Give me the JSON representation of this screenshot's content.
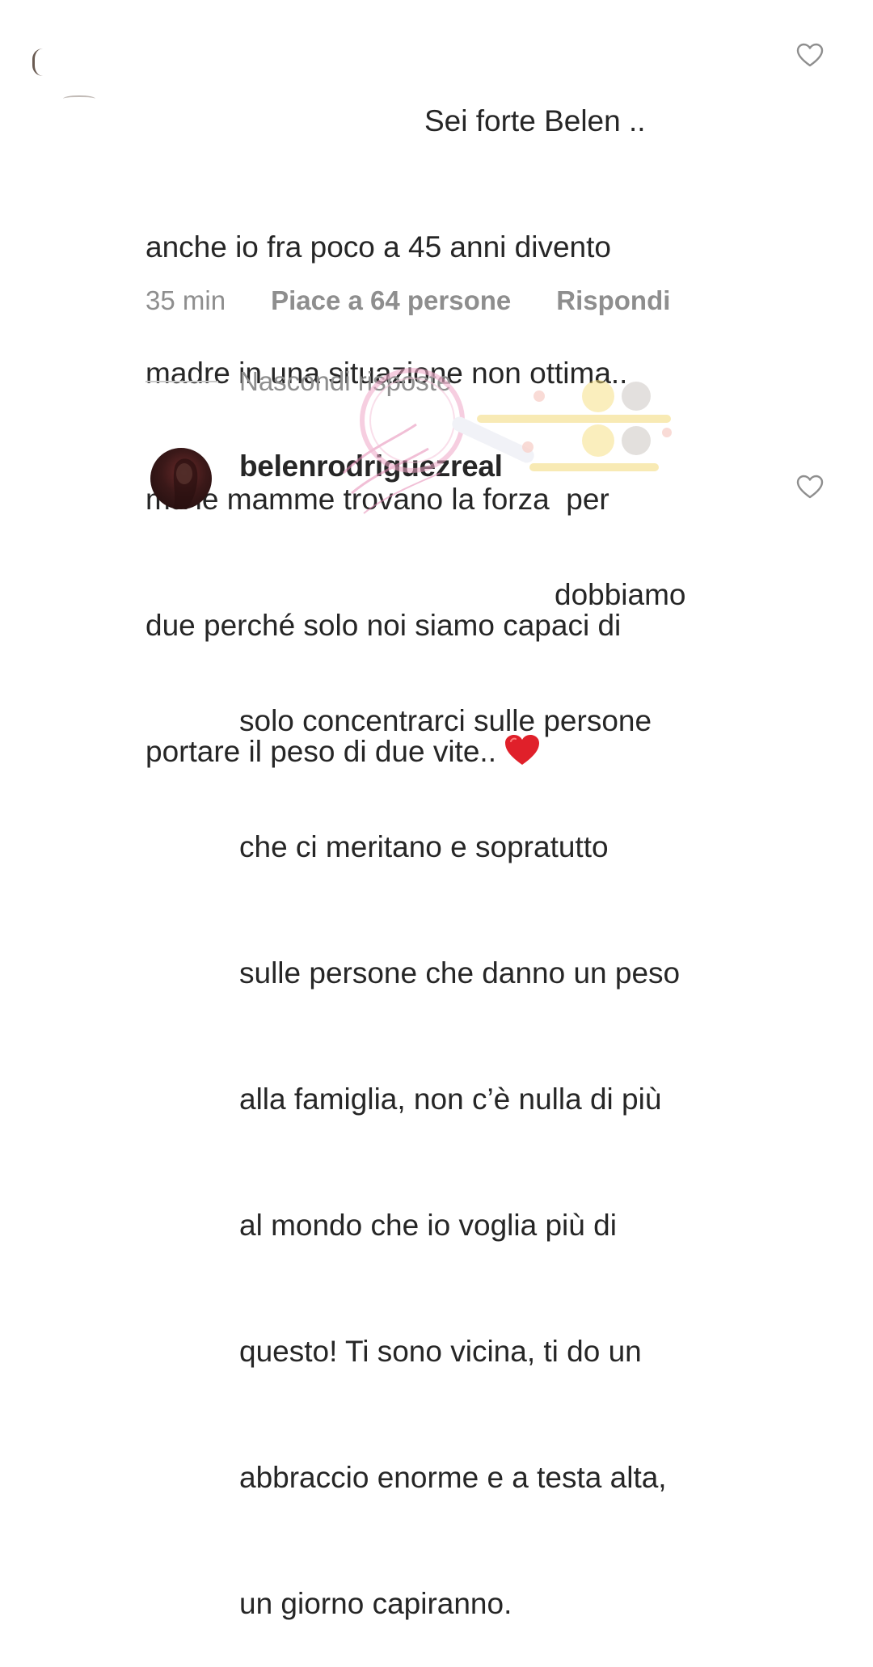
{
  "comment1": {
    "text_lines": [
      "Sei forte Belen ..",
      "anche io fra poco a 45 anni divento",
      "madre in una situazione non ottima..",
      "ma le mamme trovano la forza  per",
      "due perché solo noi siamo capaci di",
      "portare il peso di due vite.."
    ],
    "emoji": "heart-emoji",
    "time": "35 min",
    "likes": "Piace a 64 persone",
    "reply": "Rispondi",
    "like_icon": "heart-outline-icon"
  },
  "replies_toggle": {
    "label": "Nascondi risposte"
  },
  "reply1": {
    "username": "belenrodriguezreal",
    "text_lines": [
      "dobbiamo",
      "solo concentrarci sulle persone",
      "che ci meritano e sopratutto",
      "sulle persone che danno un peso",
      "alla famiglia, non c’è nulla di più",
      "al mondo che io voglia più di",
      "questo! Ti sono vicina, ti do un",
      "abbraccio enorme e a testa alta,",
      "un giorno capiranno."
    ],
    "like_icon": "heart-outline-icon"
  },
  "colors": {
    "text": "#262626",
    "secondary": "#8e8e8e",
    "heart_red": "#e0202a"
  }
}
